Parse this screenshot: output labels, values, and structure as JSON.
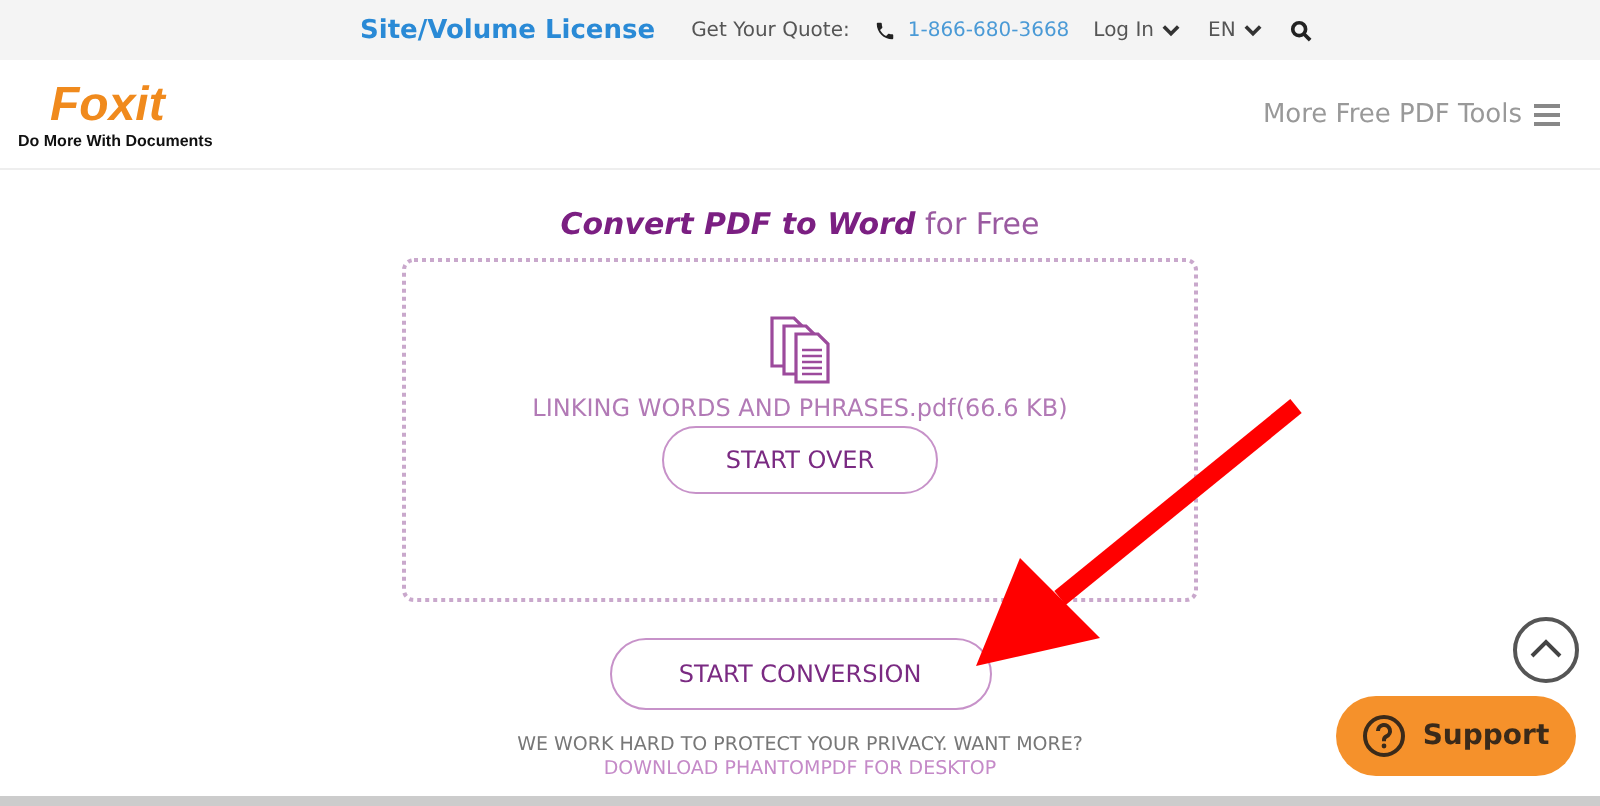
{
  "top_bar": {
    "license_link": "Site/Volume License",
    "quote_label": "Get Your Quote:",
    "phone": "1-866-680-3668",
    "login": "Log In",
    "language": "EN"
  },
  "header": {
    "logo": "Foxit",
    "tagline": "Do More With Documents",
    "tools_menu": "More Free PDF Tools"
  },
  "converter": {
    "title": "**Convert PDF to Word** for Free",
    "file_name": "LINKING WORDS AND PHRASES.pdf(66.6 KB)",
    "start_over": "START OVER",
    "start_conversion": "START CONVERSION",
    "privacy_note": "WE WORK HARD TO PROTECT YOUR PRIVACY. WANT MORE?",
    "download_link": "DOWNLOAD PHANTOMPDF FOR DESKTOP"
  },
  "support_button": "Support"
}
